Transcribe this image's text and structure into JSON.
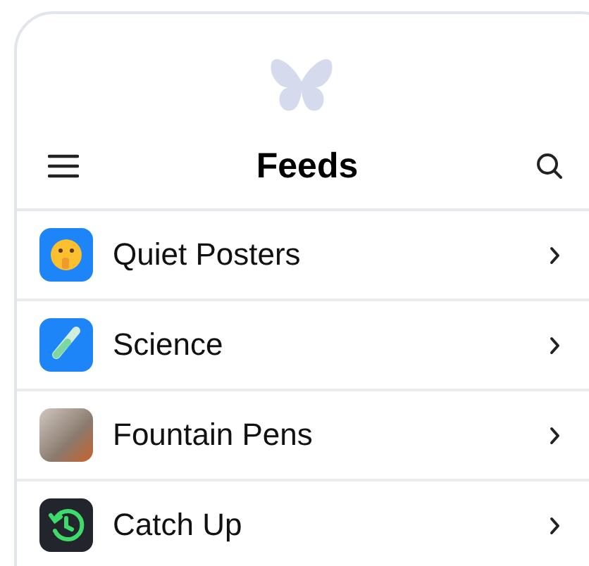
{
  "header": {
    "title": "Feeds"
  },
  "feeds": [
    {
      "name": "Quiet Posters",
      "kind": "emoji"
    },
    {
      "name": "Science",
      "kind": "tube"
    },
    {
      "name": "Fountain Pens",
      "kind": "photo"
    },
    {
      "name": "Catch Up",
      "kind": "clock"
    }
  ]
}
